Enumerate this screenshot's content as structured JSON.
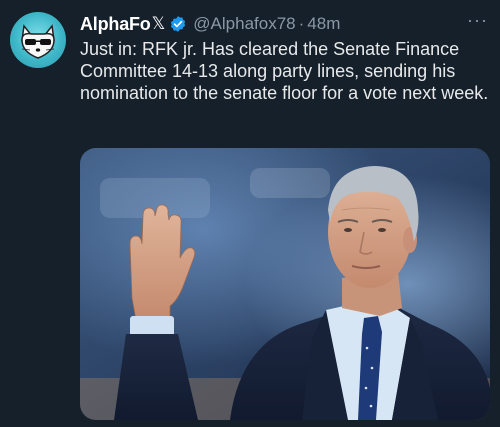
{
  "author": {
    "name": "AlphaFo",
    "name_suffix": "𝕏",
    "handle": "@Alphafox78",
    "separator": "·",
    "time": "48m",
    "verified": true,
    "avatar_icon": "fox-with-sunglasses-avatar-icon"
  },
  "tweet": {
    "text": "Just in: RFK jr. Has cleared the Senate Finance Committee 14-13 along party lines, sending his nomination to the senate floor for a vote next week.",
    "more_label": "···"
  },
  "media": {
    "description_icon": "photo-man-raising-hand-icon"
  },
  "colors": {
    "background": "#15202b",
    "text": "#e7e9ea",
    "secondary_text": "#8b98a5",
    "verified_badge": "#1d9bf0",
    "avatar_bg": "#3fb7c9"
  }
}
